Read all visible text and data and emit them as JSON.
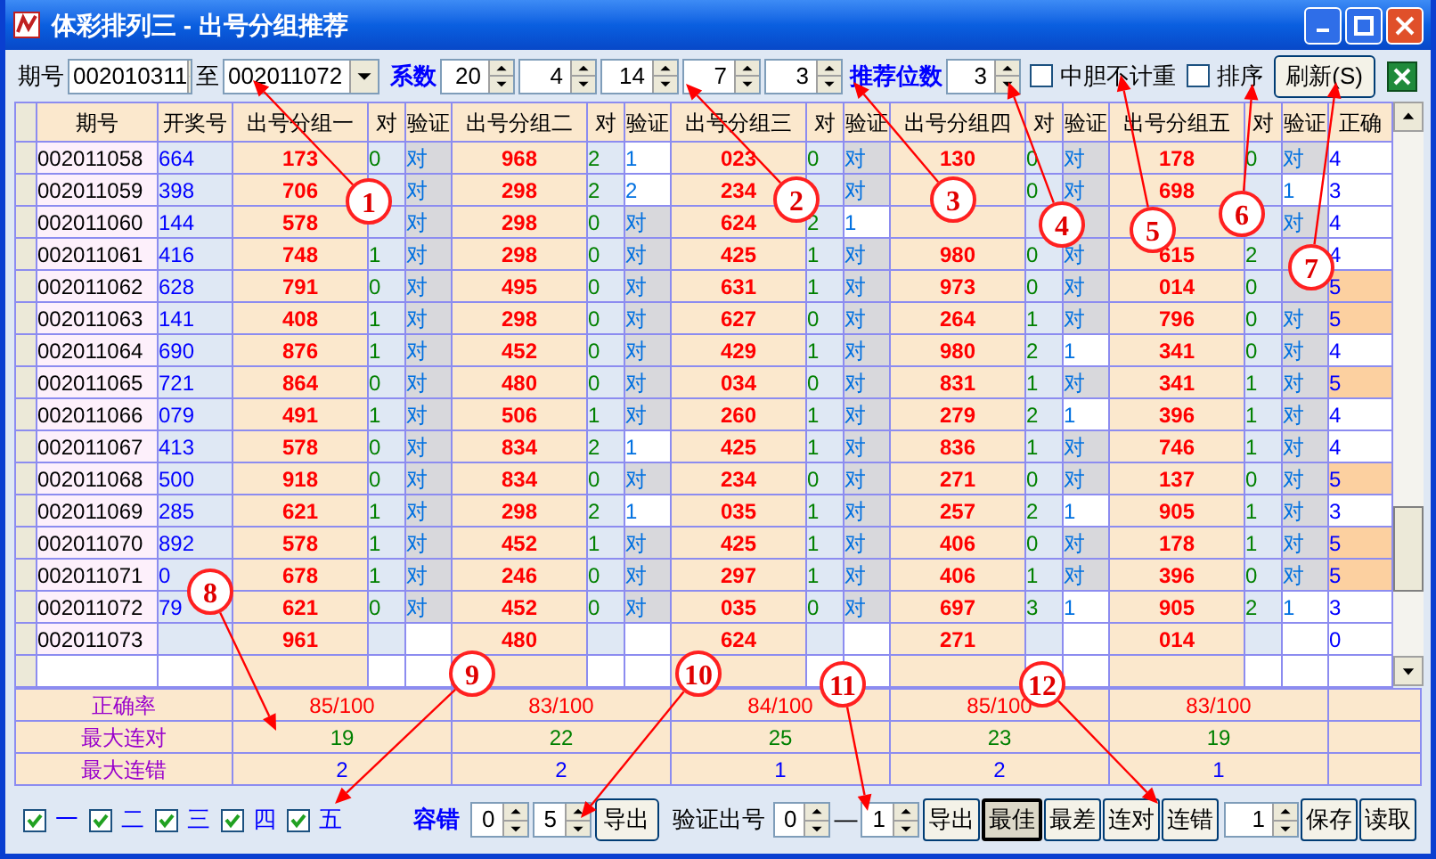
{
  "window": {
    "title": "体彩排列三 - 出号分组推荐"
  },
  "toolbar": {
    "period_label": "期号",
    "from": "002010311",
    "to_label": "至",
    "to": "002011072",
    "coef_label": "系数",
    "coefs": [
      "20",
      "4",
      "14",
      "7",
      "3"
    ],
    "recommend_label": "推荐位数",
    "recommend": "3",
    "no_repeat": {
      "label": "中胆不计重",
      "checked": false
    },
    "sort": {
      "label": "排序",
      "checked": false
    },
    "refresh": "刷新(S)"
  },
  "table": {
    "columns": [
      "期号",
      "开奖号",
      "出号分组一",
      "对",
      "验证",
      "出号分组二",
      "对",
      "验证",
      "出号分组三",
      "对",
      "验证",
      "出号分组四",
      "对",
      "验证",
      "出号分组五",
      "对",
      "验证",
      "正确"
    ],
    "rows": [
      {
        "period": "002011058",
        "draw": "664",
        "groups": [
          {
            "value": "173",
            "hits": "0",
            "verify": "对",
            "hit": true
          },
          {
            "value": "968",
            "hits": "2",
            "verify": "1",
            "hit": false
          },
          {
            "value": "023",
            "hits": "0",
            "verify": "对",
            "hit": true
          },
          {
            "value": "130",
            "hits": "0",
            "verify": "对",
            "hit": true
          },
          {
            "value": "178",
            "hits": "0",
            "verify": "对",
            "hit": true
          }
        ],
        "correct": "4",
        "highlight": false
      },
      {
        "period": "002011059",
        "draw": "398",
        "groups": [
          {
            "value": "706",
            "verify": "对",
            "hit": true
          },
          {
            "value": "298",
            "hits": "2",
            "verify": "2",
            "hit": false
          },
          {
            "value": "234",
            "verify": "对",
            "hit": true
          },
          {
            "hits": "0",
            "verify": "对",
            "hit": true
          },
          {
            "value": "698",
            "verify": "1",
            "hit": false
          }
        ],
        "correct": "3",
        "highlight": false
      },
      {
        "period": "002011060",
        "draw": "144",
        "groups": [
          {
            "value": "578",
            "verify": "对",
            "hit": true
          },
          {
            "value": "298",
            "hits": "0",
            "verify": "对",
            "hit": true
          },
          {
            "value": "624",
            "hits": "2",
            "verify": "1",
            "hit": false
          },
          {
            "hit": true
          },
          {
            "verify": "对",
            "hit": true
          }
        ],
        "correct": "4",
        "highlight": false
      },
      {
        "period": "002011061",
        "draw": "416",
        "groups": [
          {
            "value": "748",
            "hits": "1",
            "verify": "对",
            "hit": true
          },
          {
            "value": "298",
            "hits": "0",
            "verify": "对",
            "hit": true
          },
          {
            "value": "425",
            "hits": "1",
            "verify": "对",
            "hit": true
          },
          {
            "value": "980",
            "hits": "0",
            "verify": "对",
            "hit": true
          },
          {
            "value": "615",
            "hits": "2",
            "hit": true
          }
        ],
        "correct": "4",
        "highlight": false
      },
      {
        "period": "002011062",
        "draw": "628",
        "groups": [
          {
            "value": "791",
            "hits": "0",
            "verify": "对",
            "hit": true
          },
          {
            "value": "495",
            "hits": "0",
            "verify": "对",
            "hit": true
          },
          {
            "value": "631",
            "hits": "1",
            "verify": "对",
            "hit": true
          },
          {
            "value": "973",
            "hits": "0",
            "verify": "对",
            "hit": true
          },
          {
            "value": "014",
            "hits": "0",
            "hit": true
          }
        ],
        "correct": "5",
        "highlight": true
      },
      {
        "period": "002011063",
        "draw": "141",
        "groups": [
          {
            "value": "408",
            "hits": "1",
            "verify": "对",
            "hit": true
          },
          {
            "value": "298",
            "hits": "0",
            "verify": "对",
            "hit": true
          },
          {
            "value": "627",
            "hits": "0",
            "verify": "对",
            "hit": true
          },
          {
            "value": "264",
            "hits": "1",
            "verify": "对",
            "hit": true
          },
          {
            "value": "796",
            "hits": "0",
            "verify": "对",
            "hit": true
          }
        ],
        "correct": "5",
        "highlight": true
      },
      {
        "period": "002011064",
        "draw": "690",
        "groups": [
          {
            "value": "876",
            "hits": "1",
            "verify": "对",
            "hit": true
          },
          {
            "value": "452",
            "hits": "0",
            "verify": "对",
            "hit": true
          },
          {
            "value": "429",
            "hits": "1",
            "verify": "对",
            "hit": true
          },
          {
            "value": "980",
            "hits": "2",
            "verify": "1",
            "hit": false
          },
          {
            "value": "341",
            "hits": "0",
            "verify": "对",
            "hit": true
          }
        ],
        "correct": "4",
        "highlight": false
      },
      {
        "period": "002011065",
        "draw": "721",
        "groups": [
          {
            "value": "864",
            "hits": "0",
            "verify": "对",
            "hit": true
          },
          {
            "value": "480",
            "hits": "0",
            "verify": "对",
            "hit": true
          },
          {
            "value": "034",
            "hits": "0",
            "verify": "对",
            "hit": true
          },
          {
            "value": "831",
            "hits": "1",
            "verify": "对",
            "hit": true
          },
          {
            "value": "341",
            "hits": "1",
            "verify": "对",
            "hit": true
          }
        ],
        "correct": "5",
        "highlight": true
      },
      {
        "period": "002011066",
        "draw": "079",
        "groups": [
          {
            "value": "491",
            "hits": "1",
            "verify": "对",
            "hit": true
          },
          {
            "value": "506",
            "hits": "1",
            "verify": "对",
            "hit": true
          },
          {
            "value": "260",
            "hits": "1",
            "verify": "对",
            "hit": true
          },
          {
            "value": "279",
            "hits": "2",
            "verify": "1",
            "hit": false
          },
          {
            "value": "396",
            "hits": "1",
            "verify": "对",
            "hit": true
          }
        ],
        "correct": "4",
        "highlight": false
      },
      {
        "period": "002011067",
        "draw": "413",
        "groups": [
          {
            "value": "578",
            "hits": "0",
            "verify": "对",
            "hit": true
          },
          {
            "value": "834",
            "hits": "2",
            "verify": "1",
            "hit": false
          },
          {
            "value": "425",
            "hits": "1",
            "verify": "对",
            "hit": true
          },
          {
            "value": "836",
            "hits": "1",
            "verify": "对",
            "hit": true
          },
          {
            "value": "746",
            "hits": "1",
            "verify": "对",
            "hit": true
          }
        ],
        "correct": "4",
        "highlight": false
      },
      {
        "period": "002011068",
        "draw": "500",
        "groups": [
          {
            "value": "918",
            "hits": "0",
            "verify": "对",
            "hit": true
          },
          {
            "value": "834",
            "hits": "0",
            "verify": "对",
            "hit": true
          },
          {
            "value": "234",
            "hits": "0",
            "verify": "对",
            "hit": true
          },
          {
            "value": "271",
            "hits": "0",
            "verify": "对",
            "hit": true
          },
          {
            "value": "137",
            "hits": "0",
            "verify": "对",
            "hit": true
          }
        ],
        "correct": "5",
        "highlight": true
      },
      {
        "period": "002011069",
        "draw": "285",
        "groups": [
          {
            "value": "621",
            "hits": "1",
            "verify": "对",
            "hit": true
          },
          {
            "value": "298",
            "hits": "2",
            "verify": "1",
            "hit": false
          },
          {
            "value": "035",
            "hits": "1",
            "verify": "对",
            "hit": true
          },
          {
            "value": "257",
            "hits": "2",
            "verify": "1",
            "hit": false
          },
          {
            "value": "905",
            "hits": "1",
            "verify": "对",
            "hit": true
          }
        ],
        "correct": "3",
        "highlight": false
      },
      {
        "period": "002011070",
        "draw": "892",
        "groups": [
          {
            "value": "578",
            "hits": "1",
            "verify": "对",
            "hit": true
          },
          {
            "value": "452",
            "hits": "1",
            "verify": "对",
            "hit": true
          },
          {
            "value": "425",
            "hits": "1",
            "verify": "对",
            "hit": true
          },
          {
            "value": "406",
            "hits": "0",
            "verify": "对",
            "hit": true
          },
          {
            "value": "178",
            "hits": "1",
            "verify": "对",
            "hit": true
          }
        ],
        "correct": "5",
        "highlight": true
      },
      {
        "period": "002011071",
        "draw": "0",
        "groups": [
          {
            "value": "678",
            "hits": "1",
            "verify": "对",
            "hit": true
          },
          {
            "value": "246",
            "hits": "0",
            "verify": "对",
            "hit": true
          },
          {
            "value": "297",
            "hits": "1",
            "verify": "对",
            "hit": true
          },
          {
            "value": "406",
            "hits": "1",
            "verify": "对",
            "hit": true
          },
          {
            "value": "396",
            "hits": "0",
            "verify": "对",
            "hit": true
          }
        ],
        "correct": "5",
        "highlight": true
      },
      {
        "period": "002011072",
        "draw": "79",
        "groups": [
          {
            "value": "621",
            "hits": "0",
            "verify": "对",
            "hit": true
          },
          {
            "value": "452",
            "hits": "0",
            "verify": "对",
            "hit": true
          },
          {
            "value": "035",
            "hits": "0",
            "verify": "对",
            "hit": true
          },
          {
            "value": "697",
            "hits": "3",
            "verify": "1",
            "hit": false
          },
          {
            "value": "905",
            "hits": "2",
            "verify": "1",
            "hit": false
          }
        ],
        "correct": "3",
        "highlight": false
      },
      {
        "period": "002011073",
        "groups": [
          {
            "value": "961"
          },
          {
            "value": "480"
          },
          {
            "value": "624"
          },
          {
            "value": "271"
          },
          {
            "value": "014"
          }
        ],
        "correct": "0",
        "highlight": false
      }
    ]
  },
  "summary": [
    {
      "kind": "rate",
      "label": "正确率",
      "values": [
        "85/100",
        "83/100",
        "84/100",
        "85/100",
        "83/100"
      ]
    },
    {
      "kind": "max_hit",
      "label": "最大连对",
      "values": [
        "19",
        "22",
        "25",
        "23",
        "19"
      ]
    },
    {
      "kind": "max_miss",
      "label": "最大连错",
      "values": [
        "2",
        "2",
        "1",
        "2",
        "1"
      ]
    }
  ],
  "bottom": {
    "groups": [
      {
        "label": "一",
        "checked": true
      },
      {
        "label": "二",
        "checked": true
      },
      {
        "label": "三",
        "checked": true
      },
      {
        "label": "四",
        "checked": true
      },
      {
        "label": "五",
        "checked": true
      }
    ],
    "tolerance_label": "容错",
    "tolerance": [
      "0",
      "5"
    ],
    "export": "导出",
    "verify_label": "验证出号",
    "verify_from": "0",
    "dash": "—",
    "verify_to": "1",
    "buttons": [
      {
        "label": "导出",
        "selected": false
      },
      {
        "label": "最佳",
        "selected": true
      },
      {
        "label": "最差",
        "selected": false
      },
      {
        "label": "连对",
        "selected": false
      },
      {
        "label": "连错",
        "selected": false
      }
    ],
    "count": "1",
    "save": "保存",
    "load": "读取"
  },
  "callouts": [
    "1",
    "2",
    "3",
    "4",
    "5",
    "6",
    "7",
    "8",
    "9",
    "10",
    "11",
    "12"
  ]
}
